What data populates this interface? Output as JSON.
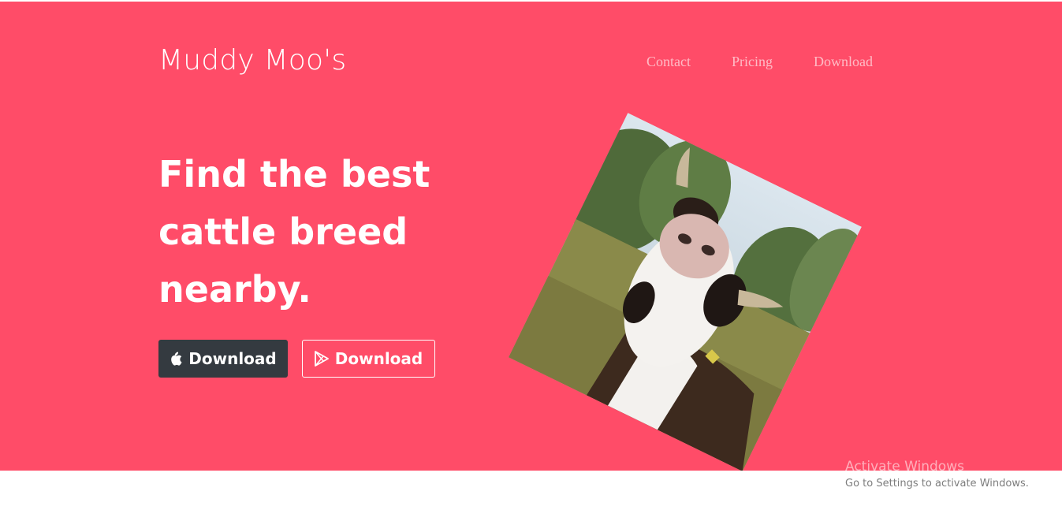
{
  "header": {
    "brand": "Muddy Moo's",
    "nav": [
      {
        "label": "Contact"
      },
      {
        "label": "Pricing"
      },
      {
        "label": "Download"
      }
    ]
  },
  "hero": {
    "headline_lines": [
      "Find the best",
      "cattle breed",
      "nearby."
    ],
    "buttons": {
      "apple": {
        "label": "Download",
        "icon": "apple-icon"
      },
      "play": {
        "label": "Download",
        "icon": "play-store-icon"
      }
    },
    "background_color": "#ff4c68",
    "image_alt": "cow"
  },
  "os_watermark": {
    "title": "Activate Windows",
    "subtitle": "Go to Settings to activate Windows."
  }
}
